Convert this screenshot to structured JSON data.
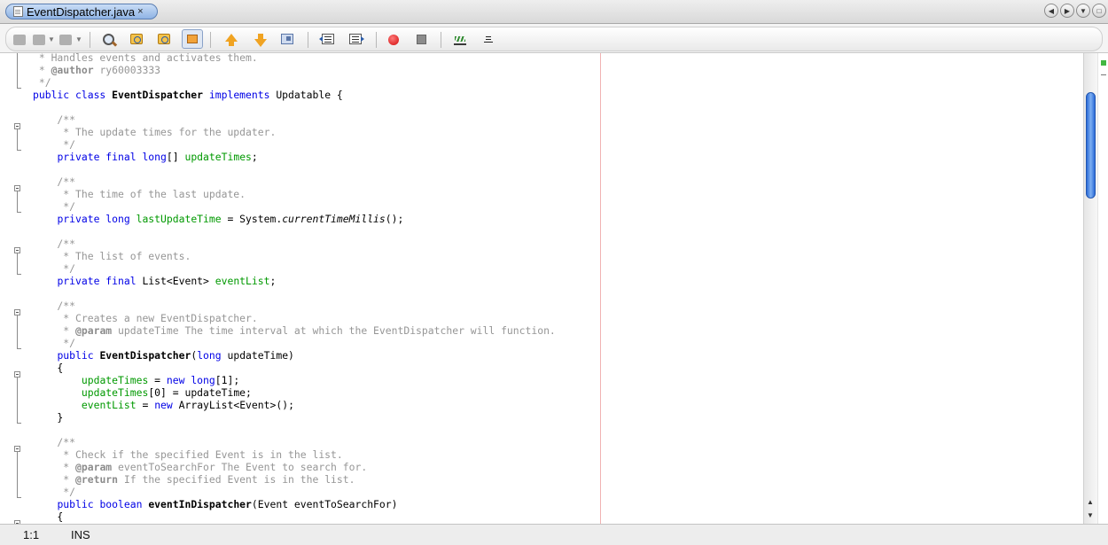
{
  "tab": {
    "label": "EventDispatcher.java",
    "close": "×"
  },
  "tab_nav": {
    "prev": "◀",
    "next": "▶",
    "menu": "▼",
    "restore": "□"
  },
  "editor": {
    "lines": [
      " * Handles events and activates them.",
      " * @author ry60003333",
      " */",
      "public class EventDispatcher implements Updatable {",
      "",
      "    /**",
      "     * The update times for the updater.",
      "     */",
      "    private final long[] updateTimes;",
      "",
      "    /**",
      "     * The time of the last update.",
      "     */",
      "    private long lastUpdateTime = System.currentTimeMillis();",
      "",
      "    /**",
      "     * The list of events.",
      "     */",
      "    private final List<Event> eventList;",
      "",
      "    /**",
      "     * Creates a new EventDispatcher.",
      "     * @param updateTime The time interval at which the EventDispatcher will function.",
      "     */",
      "    public EventDispatcher(long updateTime)",
      "    {",
      "        updateTimes = new long[1];",
      "        updateTimes[0] = updateTime;",
      "        eventList = new ArrayList<Event>();",
      "    }",
      "",
      "    /**",
      "     * Check if the specified Event is in the list.",
      "     * @param eventToSearchFor The Event to search for.",
      "     * @return If the specified Event is in the list.",
      "     */",
      "    public boolean eventInDispatcher(Event eventToSearchFor)",
      "    {"
    ]
  },
  "scrollbar": {
    "up": "▲",
    "down": "▼"
  },
  "status": {
    "position": "1:1",
    "mode": "INS"
  },
  "colors": {
    "keyword": "#0000e6",
    "field": "#009900",
    "comment": "#969696",
    "margin": "#f0b3b3",
    "thumb": "#2b6bd8"
  }
}
